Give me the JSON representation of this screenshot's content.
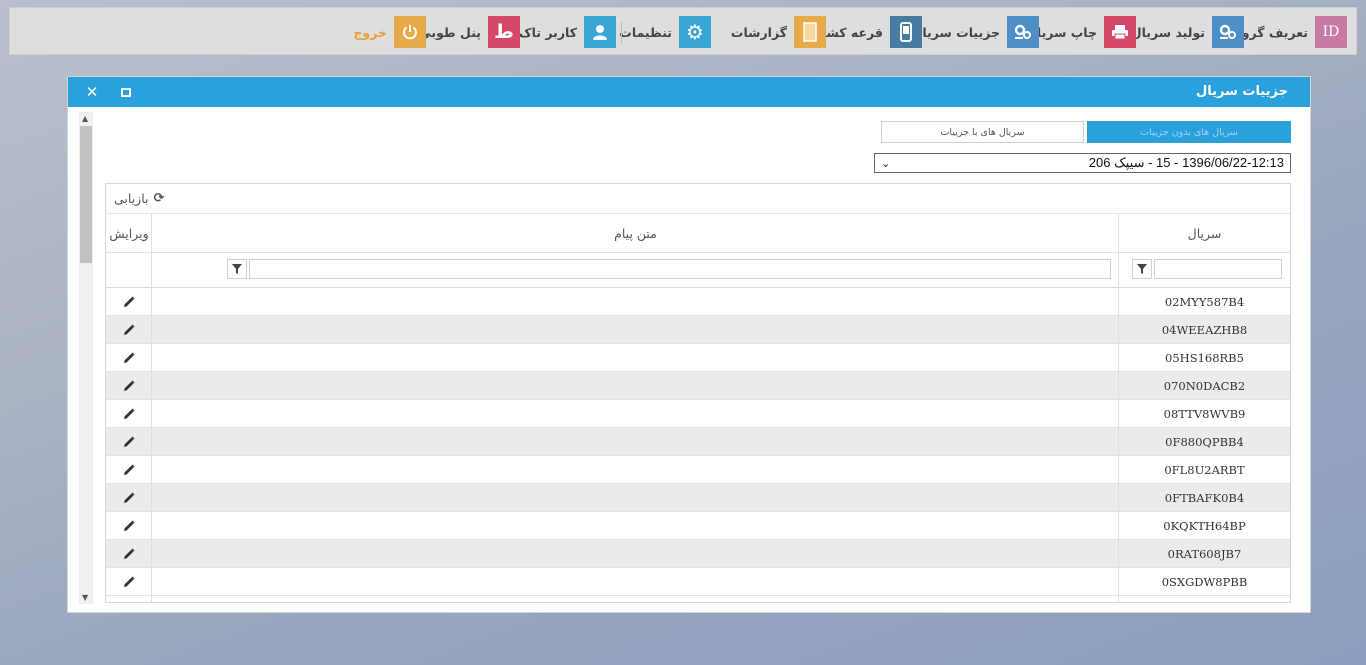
{
  "toolbar": {
    "items": [
      {
        "label": "تعریف گروه",
        "icon": "id-card-icon",
        "color": "#c87aa2"
      },
      {
        "label": "تولید سریال",
        "icon": "cogs-icon",
        "color": "#4f8fc8"
      },
      {
        "label": "چاپ سریال",
        "icon": "printer-icon",
        "color": "#d4486a"
      },
      {
        "label": "جزییات سریال",
        "icon": "cogs-icon",
        "color": "#4f8fc8"
      },
      {
        "label": "قرعه کشی",
        "icon": "mobile-icon",
        "color": "#477c9f"
      },
      {
        "label": "گزارشات",
        "icon": "document-icon",
        "color": "#e7a94a"
      },
      {
        "label": "تنظیمات",
        "icon": "gear-icon",
        "color": "#3aa6d3"
      },
      {
        "label": "کاربر تاک",
        "icon": "user-icon",
        "color": "#3aa6d3"
      },
      {
        "label": "پنل طوبی",
        "icon": "logo-icon",
        "color": "#d4486a"
      },
      {
        "label": "خروج",
        "icon": "power-icon",
        "color": "#e7a94a"
      }
    ]
  },
  "dialog": {
    "title": "جزییات سریال",
    "tabs": {
      "without_details": "سریال های بدون جزییات",
      "with_details": "سریال های با جزییات"
    },
    "select_value": "1396/06/22-12:13 - 15 - سیپک 206",
    "grid": {
      "refresh_label": "بازیابی",
      "columns": {
        "serial": "سریال",
        "message": "متن پیام",
        "edit": "ویرایش"
      },
      "rows": [
        "02MYY587B4",
        "04WEEAZHB8",
        "05HS168RB5",
        "070N0DACB2",
        "08TTV8WVB9",
        "0F880QPBB4",
        "0FL8U2ARBT",
        "0FTBAFK0B4",
        "0KQKTH64BP",
        "0RAT608JB7",
        "0SXGDW8PBB"
      ]
    }
  }
}
